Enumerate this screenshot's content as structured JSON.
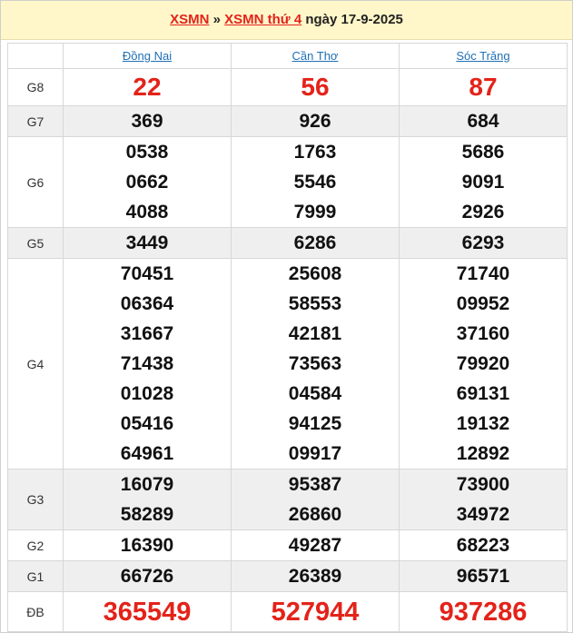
{
  "header": {
    "link1": "XSMN",
    "sep": " » ",
    "link2": "XSMN thứ 4",
    "date_text": " ngày 17-9-2025"
  },
  "provinces": [
    "Đồng Nai",
    "Cần Thơ",
    "Sóc Trăng"
  ],
  "prizes": {
    "g8": {
      "label": "G8",
      "values": [
        [
          "22"
        ],
        [
          "56"
        ],
        [
          "87"
        ]
      ]
    },
    "g7": {
      "label": "G7",
      "values": [
        [
          "369"
        ],
        [
          "926"
        ],
        [
          "684"
        ]
      ]
    },
    "g6": {
      "label": "G6",
      "values": [
        [
          "0538",
          "0662",
          "4088"
        ],
        [
          "1763",
          "5546",
          "7999"
        ],
        [
          "5686",
          "9091",
          "2926"
        ]
      ]
    },
    "g5": {
      "label": "G5",
      "values": [
        [
          "3449"
        ],
        [
          "6286"
        ],
        [
          "6293"
        ]
      ]
    },
    "g4": {
      "label": "G4",
      "values": [
        [
          "70451",
          "06364",
          "31667",
          "71438",
          "01028",
          "05416",
          "64961"
        ],
        [
          "25608",
          "58553",
          "42181",
          "73563",
          "04584",
          "94125",
          "09917"
        ],
        [
          "71740",
          "09952",
          "37160",
          "79920",
          "69131",
          "19132",
          "12892"
        ]
      ]
    },
    "g3": {
      "label": "G3",
      "values": [
        [
          "16079",
          "58289"
        ],
        [
          "95387",
          "26860"
        ],
        [
          "73900",
          "34972"
        ]
      ]
    },
    "g2": {
      "label": "G2",
      "values": [
        [
          "16390"
        ],
        [
          "49287"
        ],
        [
          "68223"
        ]
      ]
    },
    "g1": {
      "label": "G1",
      "values": [
        [
          "66726"
        ],
        [
          "26389"
        ],
        [
          "96571"
        ]
      ]
    },
    "db": {
      "label": "ĐB",
      "values": [
        [
          "365549"
        ],
        [
          "527944"
        ],
        [
          "937286"
        ]
      ]
    }
  }
}
